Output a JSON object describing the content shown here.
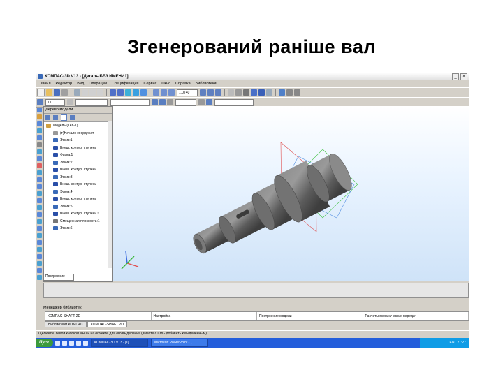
{
  "slide": {
    "title": "Згенерований раніше вал"
  },
  "window": {
    "title": "КОМПАС-3D V13 - [Деталь БЕЗ ИМЕНИ1]"
  },
  "menu": [
    "Файл",
    "Редактор",
    "Вид",
    "Операции",
    "Спецификация",
    "Сервис",
    "Окно",
    "Справка",
    "Библиотеки"
  ],
  "toolbar": {
    "scale_value": "1.0740",
    "line_value": "1.0"
  },
  "tree_panel": {
    "title": "Дерево модели",
    "tab": "Построение",
    "items": [
      {
        "label": "Модель (Тел-1)",
        "icon": "model-icon"
      },
      {
        "label": "(т)Начало координат",
        "icon": "origin-icon"
      },
      {
        "label": "Эскиз:1",
        "icon": "sketch-icon"
      },
      {
        "label": "Внеш. контур, ступень",
        "icon": "extrude-icon"
      },
      {
        "label": "Фаска:1",
        "icon": "chamfer-icon"
      },
      {
        "label": "Эскиз:2",
        "icon": "sketch-icon"
      },
      {
        "label": "Внеш. контур, ступень",
        "icon": "extrude-icon"
      },
      {
        "label": "Эскиз:3",
        "icon": "sketch-icon"
      },
      {
        "label": "Внеш. контур, ступень",
        "icon": "extrude-icon"
      },
      {
        "label": "Эскиз:4",
        "icon": "sketch-icon"
      },
      {
        "label": "Внеш. контур, ступень",
        "icon": "extrude-icon"
      },
      {
        "label": "Эскиз:5",
        "icon": "sketch-icon"
      },
      {
        "label": "Внеш. контур, ступень !",
        "icon": "extrude-icon"
      },
      {
        "label": "Смещенная плоскость:1",
        "icon": "plane-icon"
      },
      {
        "label": "Эскиз:6",
        "icon": "sketch-icon"
      }
    ]
  },
  "library_manager": {
    "title": "Менеджер библиотек",
    "items": [
      "КОМПАС-SHAFT 2D",
      "Настройка",
      "Построение модели",
      "Расчеты механических передач"
    ],
    "tabs": [
      "Библиотеки КОМПАС",
      "КОМПАС-SHAFT 2D"
    ]
  },
  "hint_text": "Щелкните левой кнопкой мыши на объекте для его выделения (вместе с Ctrl - добавить к выделенным)",
  "taskbar": {
    "start": "Пуск",
    "tasks": [
      "КОМПАС-3D V13 - [Д...",
      "Microsoft PowerPoint - [..."
    ],
    "lang": "EN",
    "clock": "21:27"
  },
  "colors": {
    "shaft": "#6e6e6e",
    "triad_x": "#e05050",
    "triad_y": "#3cb83c",
    "triad_z": "#3a6ae0",
    "taskbar": "#245edb"
  }
}
